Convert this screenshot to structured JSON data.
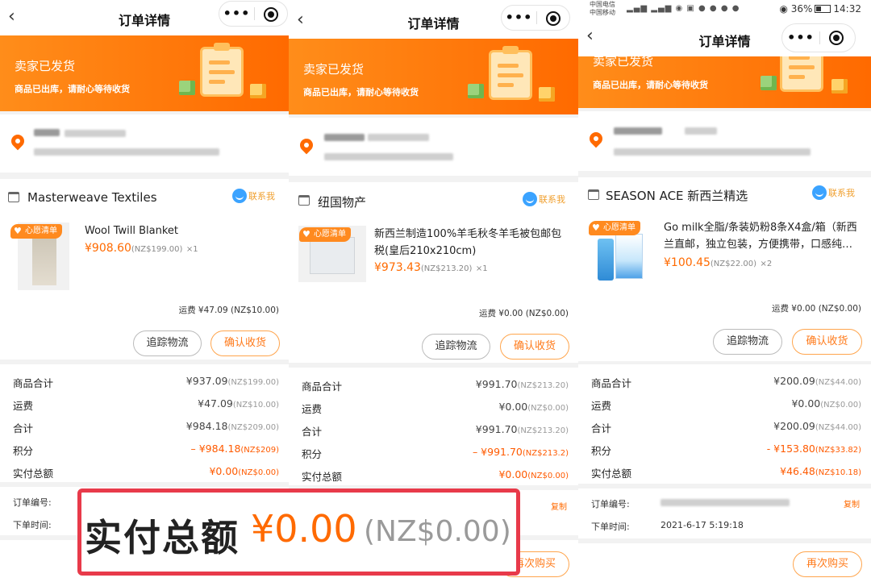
{
  "panels": [
    {
      "nav_title": "订单详情",
      "banner": {
        "title": "卖家已发货",
        "subtitle": "商品已出库，请耐心等待收货"
      },
      "store": {
        "name": "Masterweave Textiles",
        "contact": "联系我"
      },
      "product": {
        "tag": "心愿清单",
        "name": "Wool Twill Blanket",
        "price": "¥908.60",
        "price_nz": "(NZ$199.00)",
        "qty": "×1"
      },
      "shipping": "运费 ¥47.09 (NZ$10.00)",
      "buttons": {
        "track": "追踪物流",
        "confirm": "确认收货"
      },
      "summary": [
        {
          "label": "商品合计",
          "value": "¥937.09",
          "nz": "(NZ$199.00)",
          "red": false
        },
        {
          "label": "运费",
          "value": "¥47.09",
          "nz": "(NZ$10.00)",
          "red": false
        },
        {
          "label": "合计",
          "value": "¥984.18",
          "nz": "(NZ$209.00)",
          "red": false
        },
        {
          "label": "积分",
          "value": "– ¥984.18",
          "nz": "(NZ$209)",
          "red": true
        },
        {
          "label": "实付总额",
          "value": "¥0.00",
          "nz": "(NZ$0.00)",
          "red": true
        }
      ],
      "info": {
        "order_no_label": "订单编号:",
        "order_time_label": "下单时间:"
      }
    },
    {
      "nav_title": "订单详情",
      "banner": {
        "title": "卖家已发货",
        "subtitle": "商品已出库，请耐心等待收货"
      },
      "store": {
        "name": "纽国物产",
        "contact": "联系我"
      },
      "product": {
        "tag": "心愿清单",
        "name": "新西兰制造100%羊毛秋冬羊毛被包邮包税(皇后210x210cm)",
        "price": "¥973.43",
        "price_nz": "(NZ$213.20)",
        "qty": "×1"
      },
      "shipping": "运费 ¥0.00 (NZ$0.00)",
      "buttons": {
        "track": "追踪物流",
        "confirm": "确认收货",
        "rebuy": "再次购买"
      },
      "summary": [
        {
          "label": "商品合计",
          "value": "¥991.70",
          "nz": "(NZ$213.20)",
          "red": false
        },
        {
          "label": "运费",
          "value": "¥0.00",
          "nz": "(NZ$0.00)",
          "red": false
        },
        {
          "label": "合计",
          "value": "¥991.70",
          "nz": "(NZ$213.20)",
          "red": false
        },
        {
          "label": "积分",
          "value": "– ¥991.70",
          "nz": "(NZ$213.2)",
          "red": true
        },
        {
          "label": "实付总额",
          "value": "¥0.00",
          "nz": "(NZ$0.00)",
          "red": true
        }
      ],
      "info": {
        "copy": "复制"
      }
    },
    {
      "status": {
        "carrier1": "中国电信",
        "carrier2": "中国移动",
        "battery": "36%",
        "time": "14:32"
      },
      "nav_title": "订单详情",
      "banner": {
        "title": "卖家已发货",
        "subtitle": "商品已出库，请耐心等待收货"
      },
      "store": {
        "name": "SEASON ACE 新西兰精选",
        "contact": "联系我"
      },
      "product": {
        "tag": "心愿清单",
        "name": "Go milk全脂/条装奶粉8条X4盒/箱（新西兰直邮，独立包装，方便携带，口感纯…",
        "price": "¥100.45",
        "price_nz": "(NZ$22.00)",
        "qty": "×2"
      },
      "shipping": "运费 ¥0.00 (NZ$0.00)",
      "buttons": {
        "track": "追踪物流",
        "confirm": "确认收货",
        "rebuy": "再次购买"
      },
      "summary": [
        {
          "label": "商品合计",
          "value": "¥200.09",
          "nz": "(NZ$44.00)",
          "red": false
        },
        {
          "label": "运费",
          "value": "¥0.00",
          "nz": "(NZ$0.00)",
          "red": false
        },
        {
          "label": "合计",
          "value": "¥200.09",
          "nz": "(NZ$44.00)",
          "red": false
        },
        {
          "label": "积分",
          "value": "- ¥153.80",
          "nz": "(NZ$33.82)",
          "red": true
        },
        {
          "label": "实付总额",
          "value": "¥46.48",
          "nz": "(NZ$10.18)",
          "red": true
        }
      ],
      "info": {
        "order_no_label": "订单编号:",
        "order_time_label": "下单时间:",
        "order_time": "2021-6-17 5:19:18",
        "copy": "复制"
      }
    }
  ],
  "overlay": {
    "label": "实付总额",
    "amount": "¥0.00",
    "amount_nz": "(NZ$0.00)"
  },
  "colors": {
    "accent": "#ff6a00",
    "highlight_border": "#e83a4a"
  }
}
